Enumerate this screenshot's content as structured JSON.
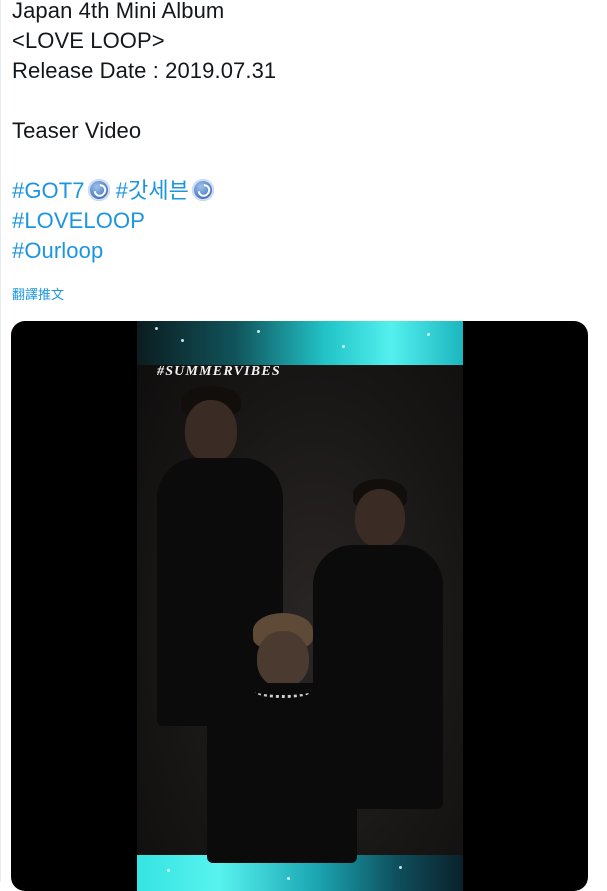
{
  "tweet": {
    "lines": [
      "Japan 4th Mini Album",
      "<LOVE LOOP>",
      "Release Date : 2019.07.31",
      "Teaser Video"
    ],
    "hashtags": [
      "#GOT7",
      "#갓세븐",
      "#LOVELOOP",
      "#Ourloop"
    ],
    "emoji": "got7-logo-emoji",
    "translate_label": "翻譯推文"
  },
  "media": {
    "caption": "#SUMMERVIBES"
  },
  "colors": {
    "link": "#1b95e0",
    "text": "#14171a",
    "media_bg": "#000000",
    "accent_glow": "#22c4c8"
  }
}
